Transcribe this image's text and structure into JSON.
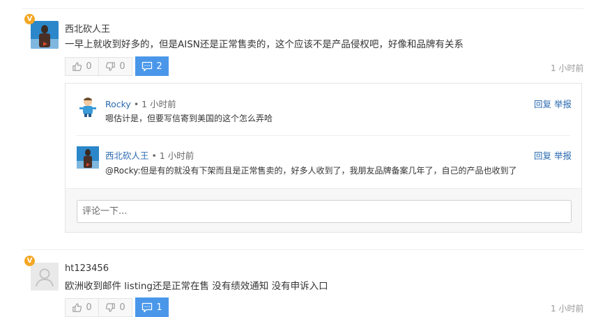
{
  "comments": [
    {
      "username": "西北砍人王",
      "text": "一早上就收到好多的，但是AISN还是正常售卖的，这个应该不是产品侵权吧，好像和品牌有关系",
      "likes": "0",
      "dislikes": "0",
      "replies": "2",
      "time": "1 小时前",
      "badge": "V"
    },
    {
      "username": "ht123456",
      "text": "欧洲收到邮件 listing还是正常在售 没有绩效通知 没有申诉入口",
      "likes": "0",
      "dislikes": "0",
      "replies": "1",
      "time": "1 小时前",
      "badge": "V"
    }
  ],
  "subreplies": [
    {
      "username": "Rocky",
      "dot": " • ",
      "time": "1 小时前",
      "text": "嗯估计是，但要写信寄到美国的这个怎么弄哈",
      "reply_label": "回复",
      "report_label": "举报"
    },
    {
      "username": "西北砍人王",
      "dot": " • ",
      "time": "1 小时前",
      "text": "@Rocky:但是有的就没有下架而且是正常售卖的，好多人收到了，我朋友品牌备案几年了，自己的产品也收到了",
      "reply_label": "回复",
      "report_label": "举报"
    }
  ],
  "reply_input": {
    "placeholder": "评论一下..."
  },
  "colors": {
    "accent_blue": "#4a97ea",
    "badge_orange": "#f5a623",
    "link_blue": "#2a6ab0"
  }
}
